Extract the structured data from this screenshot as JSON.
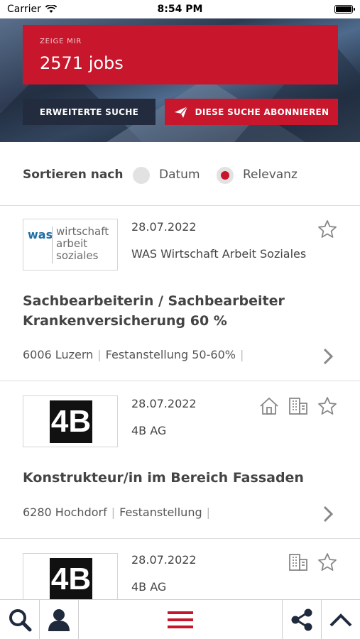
{
  "status": {
    "carrier": "Carrier",
    "time": "8:54 PM"
  },
  "hero": {
    "label": "ZEIGE MIR",
    "count": "2571 jobs",
    "advanced_label": "ERWEITERTE SUCHE",
    "subscribe_label": "DIESE SUCHE ABONNIEREN"
  },
  "sort": {
    "label": "Sortieren nach",
    "options": [
      {
        "label": "Datum",
        "selected": false
      },
      {
        "label": "Relevanz",
        "selected": true
      }
    ]
  },
  "jobs": [
    {
      "date": "28.07.2022",
      "company": "WAS Wirtschaft Arbeit Soziales",
      "logo": {
        "was": "was",
        "lines": [
          "wirtschaft",
          "arbeit",
          "soziales"
        ]
      },
      "title": "Sachbearbeiterin / Sachbearbeiter Krankenversicherung 60 %",
      "location": "6006 Luzern",
      "employment": "Festanstellung 50-60%",
      "icons": [
        "star-icon"
      ]
    },
    {
      "date": "28.07.2022",
      "company": "4B AG",
      "logo": {
        "text": "4B"
      },
      "title": "Konstrukteur/in im Bereich Fassaden",
      "location": "6280 Hochdorf",
      "employment": "Festanstellung",
      "icons": [
        "home-icon",
        "building-icon",
        "star-icon"
      ]
    },
    {
      "date": "28.07.2022",
      "company": "4B AG",
      "logo": {
        "text": "4B"
      },
      "icons": [
        "building-icon",
        "star-icon"
      ]
    }
  ],
  "tabbar": {
    "items": [
      "search-icon",
      "profile-icon",
      "menu-icon",
      "share-icon",
      "scroll-top-icon"
    ]
  },
  "colors": {
    "accent": "#c8172d",
    "dark": "#232c3e"
  }
}
